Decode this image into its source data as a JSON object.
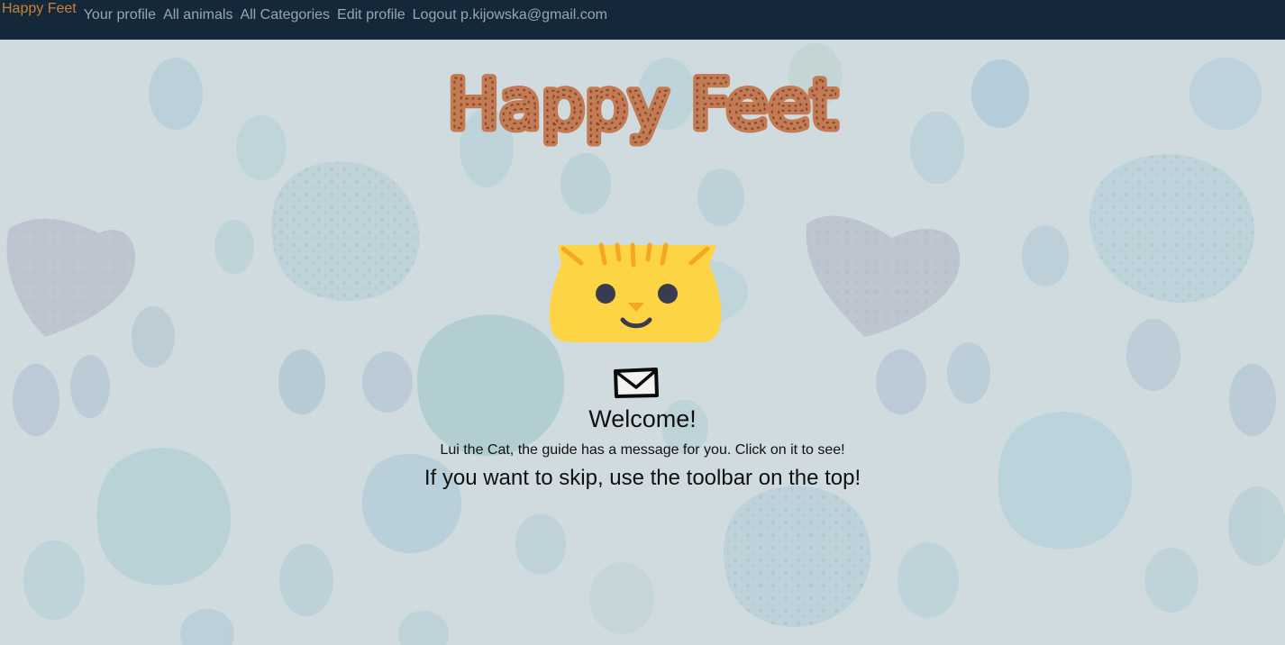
{
  "navbar": {
    "brand": "Happy Feet",
    "links": [
      {
        "label": "Your profile"
      },
      {
        "label": "All animals"
      },
      {
        "label": "All Categories"
      },
      {
        "label": "Edit profile"
      },
      {
        "label": "Logout p.kijowska@gmail.com"
      }
    ]
  },
  "hero": {
    "title": "Happy Feet",
    "title_color": "#c47a52",
    "cat_icon": "cat-face-icon",
    "envelope_icon": "envelope-icon"
  },
  "main": {
    "welcome": "Welcome!",
    "message": "Lui the Cat, the guide has a message for you. Click on it to see!",
    "skip": "If you want to skip, use the toolbar on the top!"
  },
  "colors": {
    "navbar_bg": "#14283a",
    "brand": "#c9803d",
    "nav_link": "#9aa6ae",
    "cat_yellow": "#fdd544",
    "cat_stripes": "#f5a623"
  }
}
